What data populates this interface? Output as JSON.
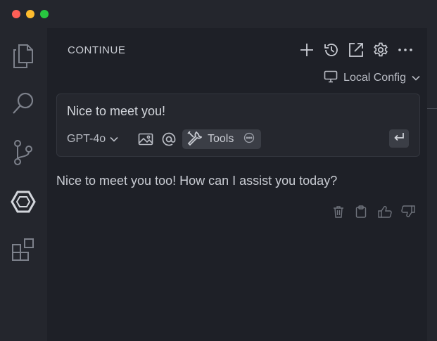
{
  "panel": {
    "title": "CONTINUE",
    "header_icons": [
      "plus-icon",
      "history-icon",
      "open-external-icon",
      "gear-icon",
      "more-icon"
    ]
  },
  "config": {
    "label": "Local Config",
    "icon": "monitor-icon"
  },
  "input": {
    "text": "Nice to meet you!",
    "model": "GPT-4o",
    "tools_label": "Tools"
  },
  "response": {
    "text": "Nice to meet you too! How can I assist you today?",
    "actions": [
      "trash-icon",
      "clipboard-icon",
      "thumbs-up-icon",
      "thumbs-down-icon"
    ]
  },
  "activitybar": [
    "explorer-icon",
    "search-icon",
    "source-control-icon",
    "continue-icon",
    "extensions-icon"
  ],
  "colors": {
    "background": "#1e2027",
    "sidebar": "#24262d",
    "chip": "#3b3e46"
  }
}
